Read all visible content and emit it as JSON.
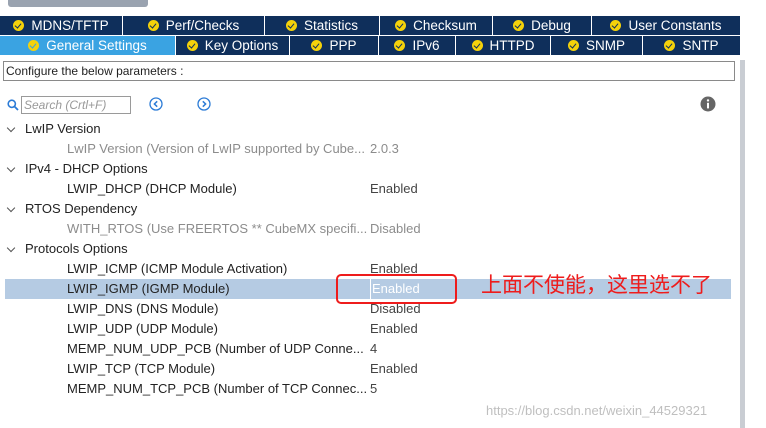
{
  "tabs_row1": [
    {
      "label": "MDNS/TFTP",
      "check": "check-icon"
    },
    {
      "label": "Perf/Checks",
      "check": "check-icon"
    },
    {
      "label": "Statistics",
      "check": "check-icon"
    },
    {
      "label": "Checksum",
      "check": "check-icon"
    },
    {
      "label": "Debug",
      "check": "check-icon"
    },
    {
      "label": "User Constants",
      "check": "check-icon"
    }
  ],
  "tabs_row2": [
    {
      "label": "General Settings",
      "active": true
    },
    {
      "label": "Key Options"
    },
    {
      "label": "PPP"
    },
    {
      "label": "IPv6"
    },
    {
      "label": "HTTPD"
    },
    {
      "label": "SNMP"
    },
    {
      "label": "SNTP"
    }
  ],
  "configure_text": "Configure the below parameters :",
  "search": {
    "placeholder": "Search (Crtl+F)"
  },
  "tree": {
    "lwip_version": {
      "title": "LwIP Version",
      "items": [
        {
          "name": "LwIP Version (Version of LwIP supported by Cube...",
          "value": "2.0.3"
        }
      ]
    },
    "dhcp_options": {
      "title": "IPv4 - DHCP Options",
      "items": [
        {
          "name": "LWIP_DHCP (DHCP Module)",
          "value": "Enabled"
        }
      ]
    },
    "rtos_dependency": {
      "title": "RTOS Dependency",
      "items": [
        {
          "name": "WITH_RTOS (Use FREERTOS ** CubeMX specifi...",
          "value": "Disabled"
        }
      ]
    },
    "protocols_options": {
      "title": "Protocols Options",
      "items": [
        {
          "name": "LWIP_ICMP (ICMP Module Activation)",
          "value": "Enabled"
        },
        {
          "name": "LWIP_IGMP (IGMP Module)",
          "value": "Enabled"
        },
        {
          "name": "LWIP_DNS (DNS Module)",
          "value": "Disabled"
        },
        {
          "name": "LWIP_UDP (UDP Module)",
          "value": "Enabled"
        },
        {
          "name": "MEMP_NUM_UDP_PCB (Number of UDP Conne...",
          "value": "4"
        },
        {
          "name": "LWIP_TCP (TCP Module)",
          "value": "Enabled"
        },
        {
          "name": "MEMP_NUM_TCP_PCB (Number of TCP Connec...",
          "value": "5"
        }
      ]
    }
  },
  "annotation": {
    "text": "上面不使能，这里选不了",
    "color": "#ee1c1c"
  },
  "watermark": "https://blog.csdn.net/weixin_44529321",
  "colors": {
    "tab_bg": "#0f2f5b",
    "tab_active": "#3aa3e2",
    "check": "#f5d20a",
    "selected_row": "#b5cbe3"
  }
}
